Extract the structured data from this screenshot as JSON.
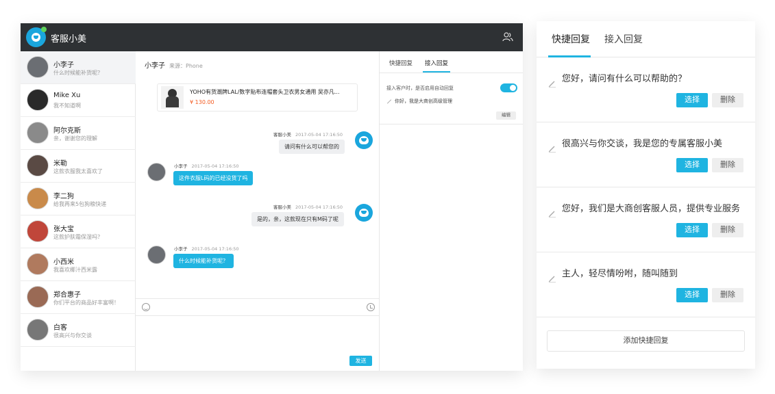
{
  "app": {
    "title": "客服小美"
  },
  "contacts": [
    {
      "name": "小李子",
      "message": "什么时候能补货呢？",
      "avatar_color": "#6b6e73",
      "active": true
    },
    {
      "name": "Mike Xu",
      "message": "我不知道啊",
      "avatar_color": "#2a2a2a",
      "active": false
    },
    {
      "name": "阿尔克斯",
      "message": "亲，谢谢您的理解",
      "avatar_color": "#8a8a8a",
      "active": false
    },
    {
      "name": "米勒",
      "message": "这款衣服我太喜欢了",
      "avatar_color": "#5a4a44",
      "active": false
    },
    {
      "name": "李二狗",
      "message": "给我再来5包狗粮快递",
      "avatar_color": "#c98a4a",
      "active": false
    },
    {
      "name": "张大宝",
      "message": "这款护肤霜保湿吗？",
      "avatar_color": "#c0463a",
      "active": false
    },
    {
      "name": "小西米",
      "message": "我喜欢椰汁西米露",
      "avatar_color": "#b07a5e",
      "active": false
    },
    {
      "name": "郑合惠子",
      "message": "你们平台的商品好丰富啊！",
      "avatar_color": "#9a6a55",
      "active": false
    },
    {
      "name": "白客",
      "message": "很高兴与你交谈",
      "avatar_color": "#777777",
      "active": false
    }
  ],
  "chat": {
    "customer_name": "小李子",
    "source": "来源：Phone",
    "product": {
      "title": "YOHO有货潮牌LAL/数字贴布连帽套头卫衣男女通用 吴亦凡...",
      "price": "¥ 130.00"
    },
    "messages": [
      {
        "sender": "客服小美",
        "time": "2017-05-04 17:16:50",
        "text": "请问有什么可以帮您的",
        "direction": "out"
      },
      {
        "sender": "小李子",
        "time": "2017-05-04 17:16:50",
        "text": "这件衣服L码的已经没货了吗",
        "direction": "in"
      },
      {
        "sender": "客服小美",
        "time": "2017-05-04 17:16:50",
        "text": "是的，亲，这款现在只有M码了呢",
        "direction": "out"
      },
      {
        "sender": "小李子",
        "time": "2017-05-04 17:16:50",
        "text": "什么时候能补货呢？",
        "direction": "in"
      }
    ],
    "send_label": "发送"
  },
  "mini_panel": {
    "tabs": [
      "快捷回复",
      "接入回复"
    ],
    "active_tab": 1,
    "auto_reply_label": "接入客户时，是否启用自动回复",
    "auto_reply_enabled": true,
    "auto_reply_text": "你好，我是大商创高级管理",
    "edit_label": "编辑"
  },
  "quick_reply": {
    "tabs": [
      "快捷回复",
      "接入回复"
    ],
    "active_tab": 0,
    "items": [
      {
        "text": "您好，请问有什么可以帮助的？",
        "select_label": "选择",
        "delete_label": "删除"
      },
      {
        "text": "很高兴与你交谈，我是您的专属客服小美",
        "select_label": "选择",
        "delete_label": "删除"
      },
      {
        "text": "您好，我们是大商创客服人员，提供专业服务",
        "select_label": "选择",
        "delete_label": "删除"
      },
      {
        "text": "主人，轻尽情吩咐，随叫随到",
        "select_label": "选择",
        "delete_label": "删除"
      }
    ],
    "add_label": "添加快捷回复"
  },
  "colors": {
    "accent": "#1fb4e1",
    "topbar": "#2e3134",
    "price": "#f35a20"
  }
}
